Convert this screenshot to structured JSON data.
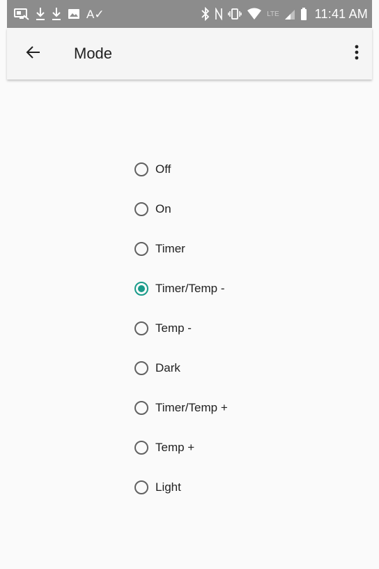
{
  "status_bar": {
    "left_icons": [
      "screen-cast-icon",
      "download-icon",
      "download-icon",
      "image-icon",
      "spellcheck-icon"
    ],
    "right_icons": [
      "bluetooth-icon",
      "nfc-icon",
      "vibrate-icon",
      "wifi-icon",
      "signal-icon",
      "battery-icon"
    ],
    "lte_label": "LTE",
    "time": "11:41 AM"
  },
  "app_bar": {
    "title": "Mode"
  },
  "mode_options": [
    {
      "label": "Off",
      "checked": false
    },
    {
      "label": "On",
      "checked": false
    },
    {
      "label": "Timer",
      "checked": false
    },
    {
      "label": "Timer/Temp -",
      "checked": true
    },
    {
      "label": "Temp -",
      "checked": false
    },
    {
      "label": "Dark",
      "checked": false
    },
    {
      "label": "Timer/Temp +",
      "checked": false
    },
    {
      "label": "Temp +",
      "checked": false
    },
    {
      "label": "Light",
      "checked": false
    }
  ],
  "colors": {
    "accent": "#1a9b8a",
    "status_bar": "#8c8c8c",
    "app_bar": "#f5f5f5",
    "background": "#fafafa"
  }
}
